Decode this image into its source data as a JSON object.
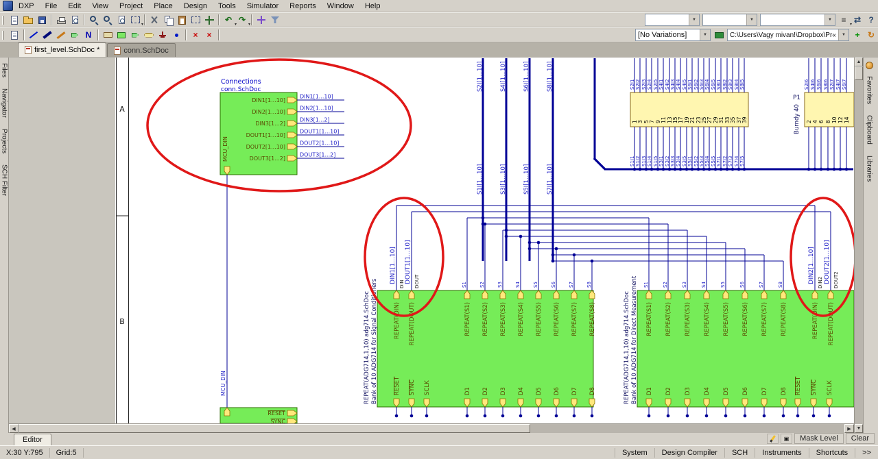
{
  "menu": {
    "items": [
      "DXP",
      "File",
      "Edit",
      "View",
      "Project",
      "Place",
      "Design",
      "Tools",
      "Simulator",
      "Reports",
      "Window",
      "Help"
    ]
  },
  "toolbars": {
    "main_icons": [
      {
        "n": "new-document",
        "s": "s-page"
      },
      {
        "n": "open-document",
        "s": "s-folder"
      },
      {
        "n": "save-document",
        "s": "s-floppy"
      },
      {
        "sep": true
      },
      {
        "n": "print",
        "s": "s-printer"
      },
      {
        "n": "print-preview",
        "s": "s-magpage"
      },
      {
        "sep": true
      },
      {
        "n": "zoom-in",
        "s": "s-mag"
      },
      {
        "n": "zoom-out",
        "s": "s-mag"
      },
      {
        "n": "zoom-document",
        "s": "s-magpage"
      },
      {
        "n": "zoom-area",
        "s": "s-selrect",
        "dd": true
      },
      {
        "sep": true
      },
      {
        "n": "cut",
        "s": "s-cut"
      },
      {
        "n": "copy",
        "s": "s-copy"
      },
      {
        "n": "paste",
        "s": "s-paste"
      },
      {
        "n": "select-area",
        "s": "s-selrect"
      },
      {
        "n": "move-selection",
        "s": "s-move"
      },
      {
        "sep": true
      },
      {
        "n": "undo",
        "g": "↶",
        "c": "#1C6E1C",
        "dd": true
      },
      {
        "n": "redo",
        "g": "↷",
        "c": "#1C6E1C",
        "dd": true
      },
      {
        "sep": true
      },
      {
        "n": "cross-probe",
        "s": "s-cross"
      },
      {
        "n": "filter",
        "s": "s-filter"
      }
    ],
    "main_combos": [
      "",
      "",
      ""
    ],
    "main_right_icons": [
      {
        "n": "customize-toolbar",
        "g": "≡",
        "c": "#333333",
        "dd": true
      },
      {
        "n": "window-arrange",
        "g": "⇄",
        "c": "#2E4A6E"
      },
      {
        "n": "help",
        "g": "?",
        "c": "#2E4A6E"
      }
    ],
    "wiring_icons": [
      {
        "n": "document-options",
        "s": "s-page"
      },
      {
        "sep": true
      },
      {
        "n": "place-wire",
        "s": "s-wire"
      },
      {
        "n": "place-bus",
        "s": "s-bus"
      },
      {
        "n": "place-signal-harness",
        "s": "s-harn"
      },
      {
        "n": "place-bus-entry",
        "s": "s-sentry"
      },
      {
        "n": "place-net-label",
        "g": "N",
        "c": "#0000B0"
      },
      {
        "sep": true
      },
      {
        "n": "place-part",
        "s": "s-part"
      },
      {
        "n": "place-sheet-symbol",
        "s": "s-sheet"
      },
      {
        "n": "place-sheet-entry",
        "s": "s-sentry"
      },
      {
        "n": "place-port",
        "s": "s-port"
      },
      {
        "n": "place-power-port",
        "s": "s-power"
      },
      {
        "n": "place-junction",
        "s": "s-junc"
      },
      {
        "sep": true
      },
      {
        "n": "place-no-erc",
        "g": "×",
        "c": "#C80000"
      },
      {
        "n": "place-compile-mask",
        "g": "×",
        "c": "#C80000"
      },
      {
        "sep": true
      }
    ],
    "variations_combo": "[No Variations]",
    "path_combo": "C:\\Users\\Vagy mivan!\\Dropbox\\Pr«",
    "wiring_right_icons": [
      {
        "n": "add-component",
        "g": "+",
        "c": "#009000"
      },
      {
        "n": "refresh-view",
        "g": "↻",
        "c": "#C87818"
      }
    ]
  },
  "document_tabs": [
    {
      "label": "first_level.SchDoc *",
      "active": true
    },
    {
      "label": "conn.SchDoc",
      "active": false
    }
  ],
  "left_panel_tabs": [
    "Files",
    "Navigator",
    "Projects",
    "SCH Filter"
  ],
  "right_panel_tabs": [
    "Favorites",
    "Clipboard",
    "Libraries"
  ],
  "bottom_bar": {
    "editor_tab": "Editor",
    "mask_level": "Mask Level",
    "clear": "Clear"
  },
  "status_bar": {
    "position": "X:30 Y:795",
    "grid": "Grid:5",
    "panels": [
      "System",
      "Design Compiler",
      "SCH",
      "Instruments",
      "Shortcuts",
      ">>"
    ]
  },
  "schematic": {
    "zone_labels": [
      "A",
      "B"
    ],
    "connections_block": {
      "title": "Connections",
      "filename": "conn.SchDoc",
      "vertical_label": "MCU_DIN",
      "entries": [
        "DIN1[1...10]",
        "DIN2[1...10]",
        "DIN3[1...2]",
        "DOUT1[1...10]",
        "DOUT2[1...10]",
        "DOUT3[1...2]"
      ],
      "net_labels": [
        "DIN1[1...10]",
        "DIN2[1...10]",
        "DIN3[1...2]",
        "DOUT1[1...10]",
        "DOUT2[1...10]",
        "DOUT3[1...2]"
      ]
    },
    "wire_label": "MCU_DIN",
    "bus_labels_top": [
      "S2I[1...10]",
      "S4I[1...10]",
      "S6I[1...10]",
      "S8I[1...10]"
    ],
    "bus_labels_mid": [
      "S1I[1...10]",
      "S3I[1...10]",
      "S5I[1...10]",
      "S7I[1...10]"
    ],
    "connector": {
      "designator": "P1",
      "name": "Burndy 40",
      "left_pins": [
        "1",
        "3",
        "5",
        "7",
        "9",
        "11",
        "13",
        "15",
        "17",
        "19",
        "21",
        "23",
        "25",
        "27",
        "29",
        "31",
        "33",
        "35",
        "37",
        "39"
      ],
      "right_pins": [
        "2",
        "4",
        "6",
        "8",
        "10",
        "12",
        "14"
      ],
      "top_labels": [
        "S2I1",
        "S2I2",
        "S2I3",
        "S2I4",
        "S2I5",
        "S4I1",
        "S4I2",
        "S4I3",
        "S4I4",
        "S4I5",
        "S6I1",
        "S6I2",
        "S6I3",
        "S6I4",
        "S6I5",
        "S8I1",
        "S8I2",
        "S8I3",
        "S8I4",
        "S8I5"
      ],
      "bottom_labels": [
        "S1I1",
        "S1I2",
        "S1I3",
        "S1I4",
        "S1I5",
        "S3I1",
        "S3I2",
        "S3I3",
        "S3I4",
        "S3I5",
        "S5I1",
        "S5I2",
        "S5I3",
        "S5I4",
        "S5I5",
        "S7I1",
        "S7I2",
        "S7I3",
        "S7I4",
        "S7I5"
      ],
      "right_top_labels": [
        "S2I6",
        "S4I6",
        "S6I6",
        "S8I6",
        "S2I7",
        "S4I7",
        "S6I7"
      ]
    },
    "sheets": [
      {
        "designator": "REPEAT(ADG714,1,10) adg714.SchDoc",
        "description": "Bank of 10 ADG714 for Signal Conditioners",
        "din_entry": "REPEAT(DIN)",
        "dout_entry": "REPEAT(DOUT)",
        "s_entries": [
          "REPEAT(S1)",
          "REPEAT(S2)",
          "REPEAT(S3)",
          "REPEAT(S4)",
          "REPEAT(S5)",
          "REPEAT(S6)",
          "REPEAT(S7)",
          "REPEAT(S8)"
        ],
        "d_entries": [
          "D1",
          "D2",
          "D3",
          "D4",
          "D5",
          "D6",
          "D7",
          "D8"
        ],
        "bottom_entries": [
          "RESET",
          "SYNC",
          "SCLK"
        ],
        "net_din": "DIN1[1...10]",
        "net_dout": "DOUT1[1...10]",
        "din_tag": "DIN",
        "dout_tag": "DOUT",
        "s_labels": [
          "S1",
          "S2",
          "S3",
          "S4",
          "S5",
          "S6",
          "S7",
          "S8"
        ]
      },
      {
        "designator": "REPEAT(ADG714,1,10) adg714.SchDoc",
        "description": "Bank of 10 ADG714 for Direct Measurement",
        "din_entry": "REPEAT(DIN)",
        "dout_entry": "REPEAT(DOUT)",
        "s_entries": [
          "REPEAT(S1)",
          "REPEAT(S2)",
          "REPEAT(S3)",
          "REPEAT(S4)",
          "REPEAT(S5)",
          "REPEAT(S6)",
          "REPEAT(S7)",
          "REPEAT(S8)"
        ],
        "d_entries": [
          "D1",
          "D2",
          "D3",
          "D4",
          "D5",
          "D6",
          "D7",
          "D8"
        ],
        "bottom_entries": [
          "RESET",
          "SYNC",
          "SCLK"
        ],
        "net_din": "DIN2[1...10]",
        "net_dout": "DOUT2[1...10]",
        "din_tag": "DIN2",
        "dout_tag": "DOUT2",
        "s_labels": [
          "S1",
          "S2",
          "S3",
          "S4",
          "S5",
          "S6",
          "S7",
          "S8"
        ]
      }
    ],
    "bottom_block": {
      "entries": [
        "RESET",
        "SYNC"
      ]
    }
  }
}
